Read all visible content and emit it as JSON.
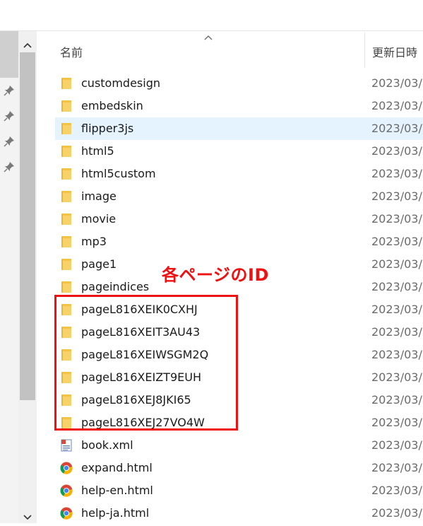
{
  "header": {
    "name_column": "名前",
    "date_column": "更新日時"
  },
  "files": [
    {
      "name": "customdesign",
      "date": "2023/03/",
      "icon": "folder-icon"
    },
    {
      "name": "embedskin",
      "date": "2023/03/",
      "icon": "folder-icon"
    },
    {
      "name": "flipper3js",
      "date": "2023/03/",
      "icon": "folder-icon",
      "selected": true
    },
    {
      "name": "html5",
      "date": "2023/03/",
      "icon": "folder-icon"
    },
    {
      "name": "html5custom",
      "date": "2023/03/",
      "icon": "folder-icon"
    },
    {
      "name": "image",
      "date": "2023/03/",
      "icon": "folder-icon"
    },
    {
      "name": "movie",
      "date": "2023/03/",
      "icon": "folder-icon"
    },
    {
      "name": "mp3",
      "date": "2023/03/",
      "icon": "folder-icon"
    },
    {
      "name": "page1",
      "date": "2023/03/",
      "icon": "folder-icon"
    },
    {
      "name": "pageindices",
      "date": "2023/03/",
      "icon": "folder-icon"
    },
    {
      "name": "pageL816XEIK0CXHJ",
      "date": "2023/03/",
      "icon": "folder-icon"
    },
    {
      "name": "pageL816XEIT3AU43",
      "date": "2023/03/",
      "icon": "folder-icon"
    },
    {
      "name": "pageL816XEIWSGM2Q",
      "date": "2023/03/",
      "icon": "folder-icon"
    },
    {
      "name": "pageL816XEIZT9EUH",
      "date": "2023/03/",
      "icon": "folder-icon"
    },
    {
      "name": "pageL816XEJ8JKI65",
      "date": "2023/03/",
      "icon": "folder-icon"
    },
    {
      "name": "pageL816XEJ27VO4W",
      "date": "2023/03/",
      "icon": "folder-icon"
    },
    {
      "name": "book.xml",
      "date": "2023/03/",
      "icon": "xml-file-icon"
    },
    {
      "name": "expand.html",
      "date": "2023/03/",
      "icon": "chrome-html-icon"
    },
    {
      "name": "help-en.html",
      "date": "2023/03/",
      "icon": "chrome-html-icon"
    },
    {
      "name": "help-ja.html",
      "date": "2023/03/",
      "icon": "chrome-html-icon"
    }
  ],
  "annotation": {
    "text": "各ページのID",
    "color": "#ee1111"
  },
  "colors": {
    "selection": "#e5f3ff",
    "folder": "#f4c342",
    "annotation": "#ee1111"
  }
}
